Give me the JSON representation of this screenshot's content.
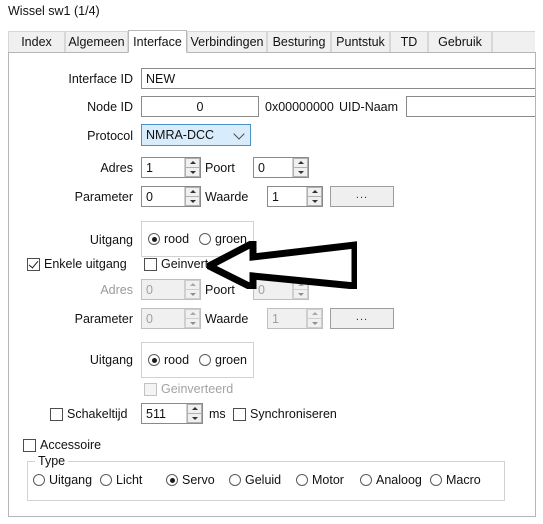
{
  "window": {
    "title": "Wissel sw1 (1/4)"
  },
  "tabs": [
    {
      "label": "Index",
      "active": false
    },
    {
      "label": "Algemeen",
      "active": false
    },
    {
      "label": "Interface",
      "active": true
    },
    {
      "label": "Verbindingen",
      "active": false
    },
    {
      "label": "Besturing",
      "active": false
    },
    {
      "label": "Puntstuk",
      "active": false
    },
    {
      "label": "TD",
      "active": false
    },
    {
      "label": "Gebruik",
      "active": false
    }
  ],
  "interface": {
    "interface_id_label": "Interface ID",
    "interface_id_value": "NEW",
    "node_id_label": "Node ID",
    "node_id_value": "0",
    "node_id_hex": "0x00000000",
    "uid_name_label": "UID-Naam",
    "uid_name_value": "",
    "protocol_label": "Protocol",
    "protocol_value": "NMRA-DCC",
    "protocol_options": [
      "NMRA-DCC"
    ]
  },
  "output1": {
    "adres_label": "Adres",
    "adres_value": "1",
    "poort_label": "Poort",
    "poort_value": "0",
    "parameter_label": "Parameter",
    "parameter_value": "0",
    "waarde_label": "Waarde",
    "waarde_value": "1",
    "browse_label": "...",
    "uitgang_label": "Uitgang",
    "radio_rood": "rood",
    "radio_groen": "groen",
    "radio_selected": "rood"
  },
  "single_output": {
    "enkele_uitgang_label": "Enkele uitgang",
    "enkele_uitgang_checked": true,
    "geinverteerd_label": "Geinverteerd",
    "geinverteerd_checked": false
  },
  "output2": {
    "adres_label": "Adres",
    "adres_value": "0",
    "poort_label": "Poort",
    "poort_value": "0",
    "parameter_label": "Parameter",
    "parameter_value": "0",
    "waarde_label": "Waarde",
    "waarde_value": "1",
    "browse_label": "...",
    "uitgang_label": "Uitgang",
    "radio_rood": "rood",
    "radio_groen": "groen",
    "radio_selected": "rood",
    "geinverteerd_label": "Geinverteerd",
    "geinverteerd_checked": false
  },
  "timing": {
    "schakeltijd_label": "Schakeltijd",
    "schakeltijd_checked": false,
    "schakeltijd_value": "511",
    "unit_label": "ms",
    "synchroniseren_label": "Synchroniseren",
    "synchroniseren_checked": false
  },
  "accessoire": {
    "label": "Accessoire",
    "checked": false
  },
  "type_group": {
    "legend": "Type",
    "selected": "Servo",
    "options": [
      {
        "label": "Uitgang"
      },
      {
        "label": "Licht"
      },
      {
        "label": "Servo"
      },
      {
        "label": "Geluid"
      },
      {
        "label": "Motor"
      },
      {
        "label": "Analoog"
      },
      {
        "label": "Macro"
      }
    ]
  },
  "annotation": {
    "kind": "left-pointing-arrow",
    "target": "Geinverteerd"
  }
}
